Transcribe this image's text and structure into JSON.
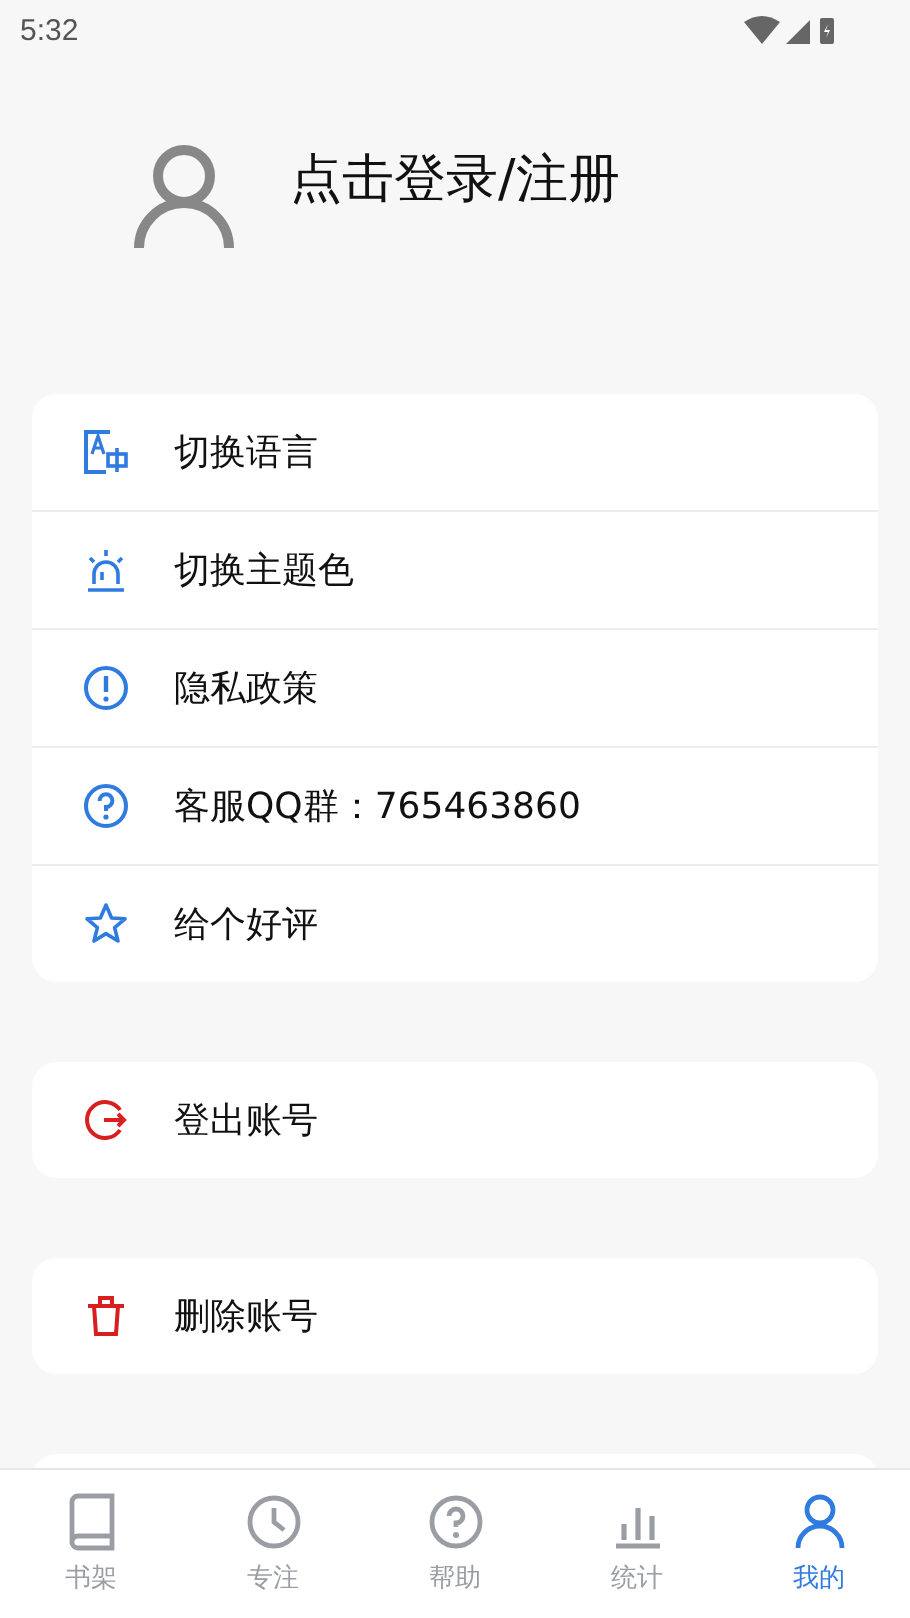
{
  "status_bar": {
    "time": "5:32"
  },
  "header": {
    "login_text": "点击登录/注册"
  },
  "groups": [
    {
      "items": [
        {
          "kind": "translate",
          "label": "切换语言"
        },
        {
          "kind": "alarm",
          "label": "切换主题色"
        },
        {
          "kind": "info",
          "label": "隐私政策"
        },
        {
          "kind": "help",
          "label": "客服QQ群：765463860"
        },
        {
          "kind": "star",
          "label": "给个好评"
        }
      ]
    },
    {
      "items": [
        {
          "kind": "logout",
          "label": "登出账号"
        }
      ]
    },
    {
      "items": [
        {
          "kind": "trash",
          "label": "删除账号"
        }
      ]
    }
  ],
  "tabs": [
    {
      "kind": "book",
      "label": "书架",
      "selected": false
    },
    {
      "kind": "clock",
      "label": "专注",
      "selected": false
    },
    {
      "kind": "help",
      "label": "帮助",
      "selected": false
    },
    {
      "kind": "chart",
      "label": "统计",
      "selected": false
    },
    {
      "kind": "person",
      "label": "我的",
      "selected": true
    }
  ]
}
